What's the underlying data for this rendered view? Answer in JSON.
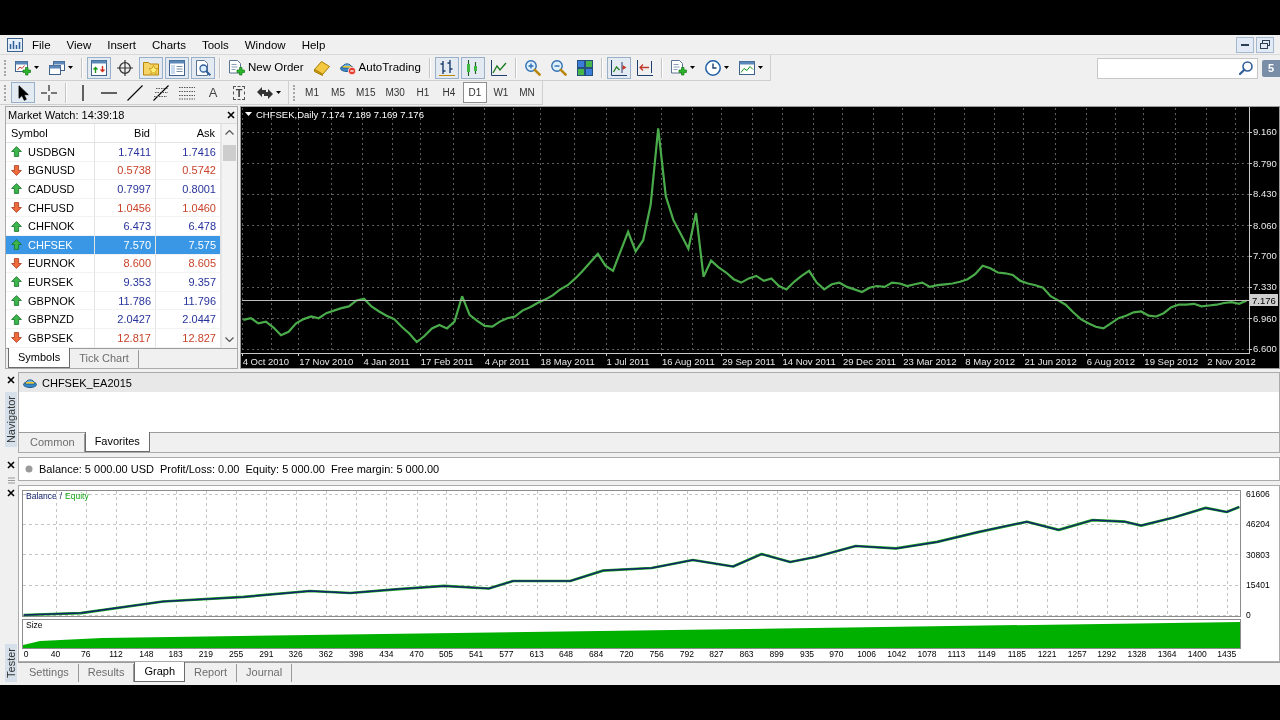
{
  "menu_bar": {
    "items": [
      "File",
      "View",
      "Insert",
      "Charts",
      "Tools",
      "Window",
      "Help"
    ]
  },
  "standard_toolbar": {
    "buttons": [
      {
        "on": false
      },
      {
        "on": false
      },
      {
        "on": true
      },
      {
        "on": false
      },
      {
        "on": true
      },
      {
        "on": true
      },
      {
        "on": true
      },
      {
        "label": "New Order",
        "on": false
      },
      {
        "on": false
      },
      {
        "label": "AutoTrading",
        "on": false
      },
      {
        "on": true
      },
      {
        "on": true
      },
      {
        "on": false
      },
      {
        "on": false
      },
      {
        "on": false
      },
      {
        "on": false
      },
      {
        "on": true
      },
      {
        "on": false
      },
      {
        "on": false
      },
      {
        "on": false
      },
      {
        "on": false
      }
    ]
  },
  "notifications": {
    "count": "5"
  },
  "drawing_toolbar": {
    "buttons": [
      {
        "selected": true
      },
      {
        "selected": false
      },
      {
        "selected": false
      },
      {
        "selected": false
      },
      {
        "selected": false
      },
      {
        "selected": false
      },
      {
        "selected": false
      },
      {
        "label": "A",
        "selected": false
      },
      {
        "label": "T",
        "selected": false
      },
      {
        "selected": false
      }
    ]
  },
  "periods_toolbar": {
    "buttons": [
      {
        "label": "M1",
        "selected": false
      },
      {
        "label": "M5",
        "selected": false
      },
      {
        "label": "M15",
        "selected": false
      },
      {
        "label": "M30",
        "selected": false
      },
      {
        "label": "H1",
        "selected": false
      },
      {
        "label": "H4",
        "selected": false
      },
      {
        "label": "D1",
        "selected": true
      },
      {
        "label": "W1",
        "selected": false
      },
      {
        "label": "MN",
        "selected": false
      }
    ]
  },
  "market_watch": {
    "title": "Market Watch: 14:39:18",
    "columns": [
      "Symbol",
      "Bid",
      "Ask"
    ],
    "rows": [
      {
        "symbol": "USDBGN",
        "bid": "1.7411",
        "ask": "1.7416",
        "up": true,
        "selected": false
      },
      {
        "symbol": "BGNUSD",
        "bid": "0.5738",
        "ask": "0.5742",
        "up": false,
        "selected": false
      },
      {
        "symbol": "CADUSD",
        "bid": "0.7997",
        "ask": "0.8001",
        "up": true,
        "selected": false
      },
      {
        "symbol": "CHFUSD",
        "bid": "1.0456",
        "ask": "1.0460",
        "up": false,
        "selected": false
      },
      {
        "symbol": "CHFNOK",
        "bid": "6.473",
        "ask": "6.478",
        "up": true,
        "selected": false
      },
      {
        "symbol": "CHFSEK",
        "bid": "7.570",
        "ask": "7.575",
        "up": true,
        "selected": true
      },
      {
        "symbol": "EURNOK",
        "bid": "8.600",
        "ask": "8.605",
        "up": false,
        "selected": false
      },
      {
        "symbol": "EURSEK",
        "bid": "9.353",
        "ask": "9.357",
        "up": true,
        "selected": false
      },
      {
        "symbol": "GBPNOK",
        "bid": "11.786",
        "ask": "11.796",
        "up": true,
        "selected": false
      },
      {
        "symbol": "GBPNZD",
        "bid": "2.0427",
        "ask": "2.0447",
        "up": true,
        "selected": false
      },
      {
        "symbol": "GBPSEK",
        "bid": "12.817",
        "ask": "12.827",
        "up": false,
        "selected": false
      }
    ],
    "tabs": [
      {
        "label": "Symbols",
        "selected": true
      },
      {
        "label": "Tick Chart",
        "selected": false
      }
    ]
  },
  "chart_window": {
    "chart_data": {
      "type": "line",
      "title": "CHFSEK,Daily 7.174 7.189 7.169 7.176",
      "grid": true,
      "categories": [
        null,
        null,
        null,
        "4 Oct 2010",
        null,
        null,
        null,
        null,
        null,
        null,
        null,
        "17 Nov 2010",
        null,
        null,
        null,
        null,
        null,
        null,
        null,
        "4 Jan 2011",
        null,
        null,
        null,
        null,
        null,
        null,
        null,
        "17 Feb 2011",
        null,
        null,
        null,
        null,
        null,
        null,
        null,
        "4 Apr 2011",
        null,
        null,
        null,
        null,
        null,
        null,
        null,
        "18 May 2011",
        null,
        null,
        null,
        null,
        null,
        null,
        null,
        "1 Jul 2011",
        null,
        null,
        null,
        null,
        null,
        null,
        null,
        "16 Aug 2011",
        null,
        null,
        null,
        null,
        null,
        null,
        null,
        "29 Sep 2011",
        null,
        null,
        null,
        null,
        null,
        null,
        null,
        "14 Nov 2011",
        null,
        null,
        null,
        null,
        null,
        null,
        null,
        "29 Dec 2011",
        null,
        null,
        null,
        null,
        null,
        null,
        null,
        "23 Mar 2012",
        null,
        null,
        null,
        null,
        null,
        null,
        null,
        "8 May 2012",
        null,
        null,
        null,
        null,
        null,
        null,
        null,
        "21 Jun 2012",
        null,
        null,
        null,
        null,
        null,
        null,
        null,
        "6 Aug 2012",
        null,
        null,
        null,
        null,
        null,
        null,
        null,
        "19 Sep 2012",
        null,
        null,
        null,
        null,
        null,
        null,
        null,
        "2 Nov 2012",
        null,
        null
      ],
      "series": [
        {
          "color": "#4aab4a",
          "values": [
            6.94,
            6.96,
            6.9,
            6.92,
            6.85,
            6.76,
            6.8,
            6.9,
            6.95,
            6.98,
            6.96,
            7.02,
            7.05,
            7.08,
            7.1,
            7.17,
            7.19,
            7.1,
            7.04,
            6.99,
            6.95,
            6.86,
            6.78,
            6.68,
            6.75,
            6.84,
            6.88,
            6.84,
            6.92,
            7.22,
            7.0,
            6.93,
            6.87,
            6.86,
            6.92,
            6.96,
            6.98,
            7.05,
            7.09,
            7.14,
            7.18,
            7.23,
            7.3,
            7.35,
            7.43,
            7.52,
            7.62,
            7.72,
            7.58,
            7.52,
            7.75,
            7.98,
            7.75,
            7.88,
            8.3,
            9.2,
            8.4,
            8.12,
            7.95,
            7.78,
            8.2,
            7.45,
            7.64,
            7.56,
            7.5,
            7.42,
            7.38,
            7.43,
            7.46,
            7.4,
            7.43,
            7.34,
            7.3,
            7.39,
            7.46,
            7.52,
            7.38,
            7.3,
            7.36,
            7.38,
            7.33,
            7.3,
            7.27,
            7.32,
            7.34,
            7.33,
            7.38,
            7.37,
            7.34,
            7.36,
            7.38,
            7.33,
            7.35,
            7.36,
            7.37,
            7.39,
            7.42,
            7.48,
            7.58,
            7.55,
            7.5,
            7.49,
            7.47,
            7.4,
            7.37,
            7.35,
            7.32,
            7.22,
            7.17,
            7.12,
            7.03,
            6.95,
            6.9,
            6.86,
            6.84,
            6.9,
            6.96,
            6.99,
            7.03,
            7.04,
            6.99,
            6.98,
            7.02,
            7.09,
            7.12,
            7.12,
            7.13,
            7.1,
            7.11,
            7.12,
            7.14,
            7.15,
            7.13,
            7.17
          ]
        }
      ],
      "ylim": [
        6.55,
        9.44
      ],
      "yticks": [
        {
          "value": 9.16,
          "label": "9.160"
        },
        {
          "value": 8.79,
          "label": "8.790"
        },
        {
          "value": 8.43,
          "label": "8.430"
        },
        {
          "value": 8.06,
          "label": "8.060"
        },
        {
          "value": 7.7,
          "label": "7.700"
        },
        {
          "value": 7.33,
          "label": "7.330"
        },
        {
          "value": 6.96,
          "label": "6.960"
        },
        {
          "value": 6.6,
          "label": "6.600"
        }
      ],
      "ref_lines": [
        {
          "axis": "y",
          "value": 7.176,
          "label": "7.176"
        }
      ]
    }
  },
  "navigator": {
    "label": "Navigator",
    "items": [
      {
        "label": "CHFSEK_EA2015",
        "selected": true
      }
    ],
    "tabs": [
      {
        "label": "Common",
        "selected": false
      },
      {
        "label": "Favorites",
        "selected": true
      }
    ]
  },
  "terminal": {
    "summary": [
      "Balance: 5 000.00 USD",
      "Profit/Loss: 0.00",
      "Equity: 5 000.00",
      "Free margin: 5 000.00"
    ]
  },
  "tester": {
    "label": "Tester",
    "graph": {
      "legend_separator": "/",
      "chart_data": {
        "type": "line",
        "grid": true,
        "x": [
          2,
          70,
          168,
          264,
          343,
          391,
          449,
          503,
          556,
          585,
          653,
          692,
          750,
          799,
          847,
          881,
          915,
          945,
          993,
          1041,
          1090,
          1139,
          1197,
          1235,
          1275,
          1314,
          1333,
          1372,
          1410,
          1435,
          1450
        ],
        "series": [
          {
            "name": "Balance",
            "color": "#15236e",
            "values": [
              0,
              1000,
              6900,
              9200,
              12200,
              11200,
              13200,
              14800,
              13500,
              17300,
              17300,
              22600,
              23900,
              28000,
              24700,
              31000,
              27000,
              29500,
              35100,
              33900,
              37200,
              42200,
              47500,
              43300,
              48300,
              47500,
              45500,
              49600,
              54500,
              52400,
              55000
            ]
          },
          {
            "name": "Equity",
            "color": "#18a818",
            "values": [
              0,
              1000,
              6900,
              9200,
              12200,
              11200,
              13200,
              14800,
              13500,
              17300,
              17300,
              22600,
              23900,
              28000,
              24700,
              31000,
              27000,
              29500,
              35100,
              33900,
              37200,
              42200,
              47500,
              43300,
              48300,
              47500,
              45500,
              49600,
              54500,
              52400,
              55000
            ]
          }
        ],
        "xlim": [
          0,
          1452
        ],
        "ylim": [
          -1000,
          63600
        ],
        "xticks": [
          0,
          40,
          76,
          112,
          148,
          183,
          219,
          255,
          291,
          326,
          362,
          398,
          434,
          470,
          505,
          541,
          577,
          613,
          648,
          684,
          720,
          756,
          792,
          827,
          863,
          899,
          935,
          970,
          1006,
          1042,
          1078,
          1113,
          1149,
          1185,
          1221,
          1257,
          1292,
          1328,
          1364,
          1400,
          1435
        ],
        "yticks": [
          0,
          15401,
          30803,
          46204,
          61606
        ]
      }
    },
    "size_panel": {
      "label": "Size"
    },
    "tabs": [
      {
        "label": "Settings",
        "selected": false
      },
      {
        "label": "Results",
        "selected": false
      },
      {
        "label": "Graph",
        "selected": true
      },
      {
        "label": "Report",
        "selected": false
      },
      {
        "label": "Journal",
        "selected": false
      }
    ]
  }
}
